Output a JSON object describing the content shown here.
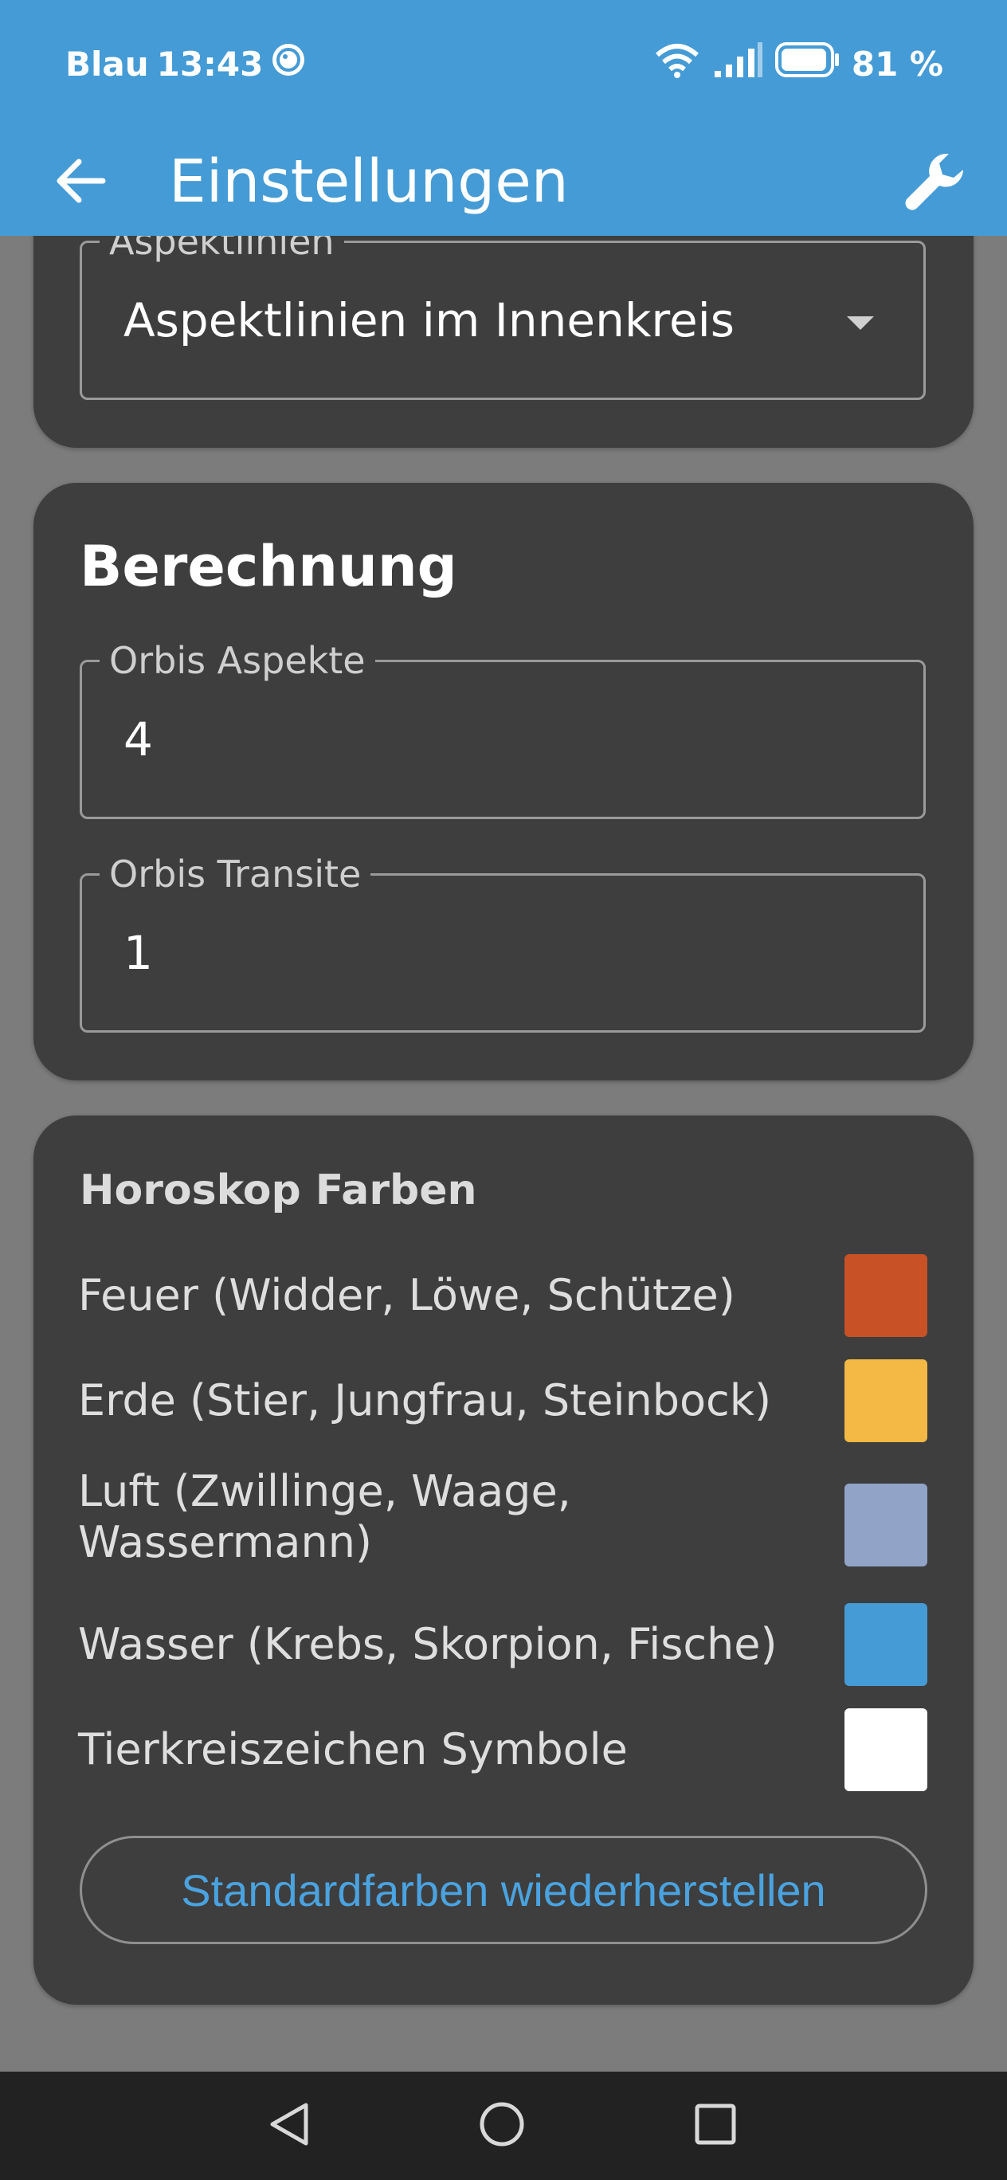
{
  "status_bar": {
    "carrier": "Blau",
    "time": "13:43",
    "battery_percent": "81 %",
    "icons": [
      "face-icon",
      "wifi-icon",
      "signal-icon",
      "battery-icon"
    ]
  },
  "app_bar": {
    "title": "Einstellungen",
    "back_icon": "arrow-left-icon",
    "action_icon": "wrench-icon"
  },
  "aspect_card": {
    "field_label": "Aspektlinien",
    "field_value": "Aspektlinien im Innenkreis"
  },
  "calc_card": {
    "title": "Berechnung",
    "orbis_aspekte_label": "Orbis Aspekte",
    "orbis_aspekte_value": "4",
    "orbis_transite_label": "Orbis Transite",
    "orbis_transite_value": "1"
  },
  "colors_card": {
    "title": "Horoskop Farben",
    "items": [
      {
        "label": "Feuer (Widder, Löwe, Schütze)",
        "color": "#c85125"
      },
      {
        "label": "Erde (Stier, Jungfrau, Steinbock)",
        "color": "#f3b944"
      },
      {
        "label": "Luft (Zwillinge, Waage, Wassermann)",
        "color": "#91a4c8"
      },
      {
        "label": "Wasser (Krebs, Skorpion, Fische)",
        "color": "#459bd5"
      },
      {
        "label": "Tierkreiszeichen Symbole",
        "color": "#ffffff"
      }
    ],
    "reset_label": "Standardfarben wiederherstellen"
  },
  "nav_bar": {
    "icons": [
      "back-triangle-icon",
      "home-circle-icon",
      "recents-square-icon"
    ]
  },
  "theme": {
    "accent": "#459bd5",
    "card_bg": "#3e3e3e",
    "page_bg": "#7c7c7c"
  }
}
